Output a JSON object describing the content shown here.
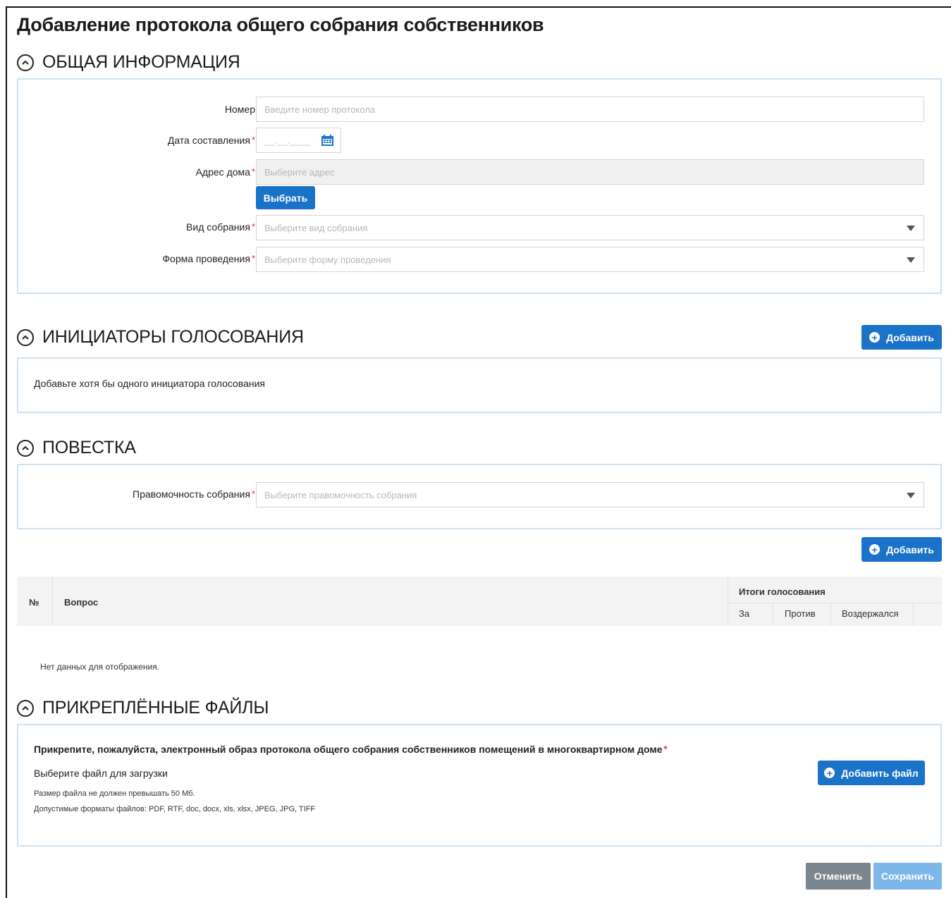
{
  "page": {
    "title": "Добавление протокола общего собрания собственников"
  },
  "general": {
    "heading": "ОБЩАЯ ИНФОРМАЦИЯ",
    "number_label": "Номер",
    "number_placeholder": "Введите номер протокола",
    "date_label": "Дата составления",
    "date_placeholder": "__.__.____",
    "address_label": "Адрес дома",
    "address_placeholder": "Выберите адрес",
    "select_button": "Выбрать",
    "meeting_type_label": "Вид собрания",
    "meeting_type_placeholder": "Выберите вид собрания",
    "form_label": "Форма проведения",
    "form_placeholder": "Выберите форму проведения",
    "required_mark": "*"
  },
  "initiators": {
    "heading": "ИНИЦИАТОРЫ ГОЛОСОВАНИЯ",
    "add_button": "Добавить",
    "empty_text": "Добавьте хотя бы одного инициатора голосования"
  },
  "agenda": {
    "heading": "ПОВЕСТКА",
    "competence_label": "Правомочность собрания",
    "competence_placeholder": "Выберите правомочность собрания",
    "add_button": "Добавить",
    "table": {
      "col_num": "№",
      "col_question": "Вопрос",
      "col_results": "Итоги голосования",
      "col_for": "За",
      "col_against": "Против",
      "col_abstained": "Воздержался"
    },
    "no_data": "Нет данных для отображения."
  },
  "files": {
    "heading": "ПРИКРЕПЛЁННЫЕ ФАЙЛЫ",
    "instruction": "Прикрепите, пожалуйста, электронный образ протокола общего собрания собственников помещений в многоквартирном доме",
    "choose_text": "Выберите файл для загрузки",
    "size_note": "Размер файла не должен превышать 50 Мб.",
    "formats_note": "Допустимые форматы файлов: PDF, RTF, doc, docx, xls, xlsx, JPEG, JPG, TIFF",
    "add_file_button": "Добавить файл"
  },
  "footer": {
    "cancel_button": "Отменить",
    "save_button": "Сохранить"
  },
  "colors": {
    "primary": "#1a73c9",
    "panel_border": "#cfe1ef",
    "required": "#e0332c",
    "cancel": "#7b8790",
    "save_disabled": "#7db6e8"
  }
}
